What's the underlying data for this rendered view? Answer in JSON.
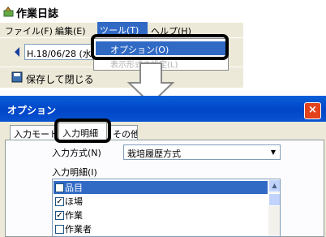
{
  "top_window": {
    "title": "作業日誌",
    "menus": [
      "ファイル(F)",
      "編集(E)",
      "ツール(T)",
      "ヘルプ(H)"
    ],
    "date_field": "H.18/06/28 (水",
    "dropdown_items": [
      "オプション(O)",
      "表示形式の設定(L)"
    ],
    "toolbar_save": "保存して閉じる"
  },
  "dialog": {
    "title": "オプション",
    "close_label": "×",
    "tabs": [
      "入力モード",
      "入力明細",
      "その他"
    ],
    "input_method_label": "入力方式(N)",
    "input_method_value": "栽培履歴方式",
    "detail_label": "入力明細(I)",
    "detail_items": [
      {
        "label": "品目",
        "checked": true
      },
      {
        "label": "ほ場",
        "checked": true
      },
      {
        "label": "作業",
        "checked": true
      },
      {
        "label": "作業者",
        "checked": false
      }
    ]
  },
  "colors": {
    "selection": "#316ac5",
    "title_bar": "#0054e3",
    "close": "#e2431c"
  }
}
